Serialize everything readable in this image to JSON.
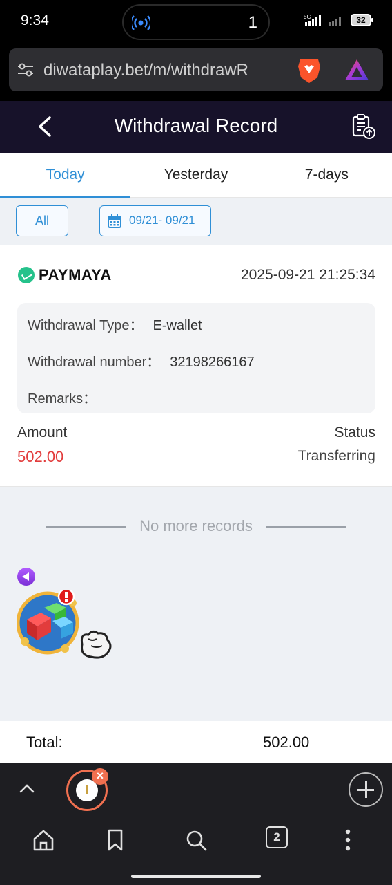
{
  "status_bar": {
    "time": "9:34",
    "island_count": "1",
    "network": "5G",
    "battery": "32"
  },
  "browser": {
    "url": "diwataplay.bet/m/withdrawR",
    "open_tabs": "2"
  },
  "header": {
    "title": "Withdrawal Record"
  },
  "tabs": [
    {
      "label": "Today",
      "active": true
    },
    {
      "label": "Yesterday",
      "active": false
    },
    {
      "label": "7-days",
      "active": false
    }
  ],
  "filters": {
    "all_label": "All",
    "date_range": "09/21- 09/21"
  },
  "record": {
    "provider": "PAYMAYA",
    "datetime": "2025-09-21 21:25:34",
    "type_label": "Withdrawal Type：",
    "type_value": "E-wallet",
    "number_label": "Withdrawal number：",
    "number_value": "32198266167",
    "remarks_label": "Remarks：",
    "remarks_value": "",
    "amount_label": "Amount",
    "amount_value": "502.00",
    "status_label": "Status",
    "status_value": "Transferring"
  },
  "empty": {
    "message": "No more records"
  },
  "total": {
    "label": "Total:",
    "value": "502.00"
  },
  "colors": {
    "accent": "#2f8fd6",
    "header_bg": "#17122a",
    "amount": "#e23c3c"
  }
}
